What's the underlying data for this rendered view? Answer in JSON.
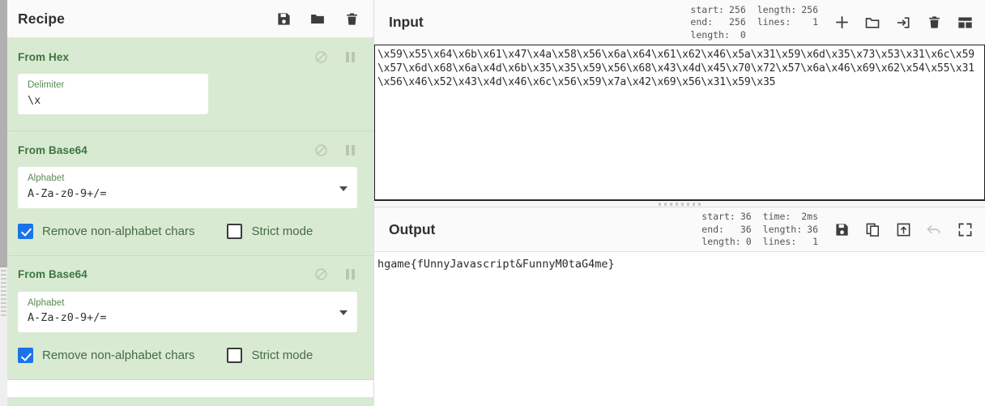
{
  "recipe": {
    "title": "Recipe",
    "toolbar": [
      {
        "name": "save-recipe-icon",
        "label": "Save recipe"
      },
      {
        "name": "load-recipe-icon",
        "label": "Load recipe"
      },
      {
        "name": "clear-recipe-icon",
        "label": "Clear recipe"
      }
    ],
    "operations": [
      {
        "name": "From Hex",
        "disable_label": "Disable operation",
        "pause_label": "Set breakpoint",
        "fields": [
          {
            "label": "Delimiter",
            "value": "\\x",
            "type": "text",
            "width": "small"
          }
        ],
        "checkboxes": []
      },
      {
        "name": "From Base64",
        "disable_label": "Disable operation",
        "pause_label": "Set breakpoint",
        "fields": [
          {
            "label": "Alphabet",
            "value": "A-Za-z0-9+/=",
            "type": "select",
            "width": "wide"
          }
        ],
        "checkboxes": [
          {
            "label": "Remove non-alphabet chars",
            "checked": true
          },
          {
            "label": "Strict mode",
            "checked": false
          }
        ]
      },
      {
        "name": "From Base64",
        "disable_label": "Disable operation",
        "pause_label": "Set breakpoint",
        "fields": [
          {
            "label": "Alphabet",
            "value": "A-Za-z0-9+/=",
            "type": "select",
            "width": "wide"
          }
        ],
        "checkboxes": [
          {
            "label": "Remove non-alphabet chars",
            "checked": true
          },
          {
            "label": "Strict mode",
            "checked": false
          }
        ]
      }
    ]
  },
  "input": {
    "title": "Input",
    "meta_left": [
      {
        "key": "start:",
        "value": "256"
      },
      {
        "key": "end:",
        "value": "256"
      },
      {
        "key": "length:",
        "value": "0"
      }
    ],
    "meta_right": [
      {
        "key": "length:",
        "value": "256"
      },
      {
        "key": "lines:",
        "value": "1"
      }
    ],
    "toolbar": [
      {
        "name": "add-input-icon",
        "label": "Add a new input tab"
      },
      {
        "name": "open-folder-icon",
        "label": "Open folder as input"
      },
      {
        "name": "open-file-icon",
        "label": "Open file as input"
      },
      {
        "name": "clear-io-icon",
        "label": "Clear input and output"
      },
      {
        "name": "tab-layout-icon",
        "label": "Reset pane layout"
      }
    ],
    "text": "\\x59\\x55\\x64\\x6b\\x61\\x47\\x4a\\x58\\x56\\x6a\\x64\\x61\\x62\\x46\\x5a\\x31\\x59\\x6d\\x35\\x73\\x53\\x31\\x6c\\x59\\x57\\x6d\\x68\\x6a\\x4d\\x6b\\x35\\x35\\x59\\x56\\x68\\x43\\x4d\\x45\\x70\\x72\\x57\\x6a\\x46\\x69\\x62\\x54\\x55\\x31\\x56\\x46\\x52\\x43\\x4d\\x46\\x6c\\x56\\x59\\x7a\\x42\\x69\\x56\\x31\\x59\\x35"
  },
  "output": {
    "title": "Output",
    "meta_left": [
      {
        "key": "start:",
        "value": "36"
      },
      {
        "key": "end:",
        "value": "36"
      },
      {
        "key": "length:",
        "value": "0"
      }
    ],
    "meta_right": [
      {
        "key": "time:",
        "value": "2ms"
      },
      {
        "key": "length:",
        "value": "36"
      },
      {
        "key": "lines:",
        "value": "1"
      }
    ],
    "toolbar": [
      {
        "name": "save-output-icon",
        "label": "Save output to file"
      },
      {
        "name": "copy-output-icon",
        "label": "Copy raw output to clipboard"
      },
      {
        "name": "replace-input-icon",
        "label": "Replace input with output"
      },
      {
        "name": "undo-icon",
        "label": "Undo",
        "disabled": true
      },
      {
        "name": "maximise-icon",
        "label": "Maximise output pane"
      }
    ],
    "text": "hgame{fUnnyJavascript&FunnyM0taG4me}"
  },
  "colors": {
    "operation_bg": "#d9ead3",
    "operation_title": "#3c763d",
    "checkbox_accent": "#1a73e8",
    "panel_header_bg": "#fafafa"
  }
}
